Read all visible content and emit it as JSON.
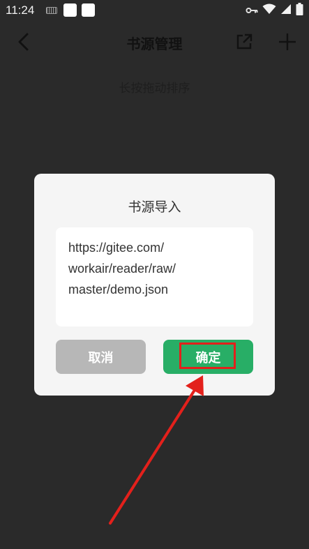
{
  "status_bar": {
    "time": "11:24"
  },
  "toolbar": {
    "title": "书源管理"
  },
  "hint": "长按拖动排序",
  "dialog": {
    "title": "书源导入",
    "url_value": "https://gitee.com/\nworkair/reader/raw/\nmaster/demo.json",
    "cancel_label": "取消",
    "confirm_label": "确定"
  },
  "colors": {
    "overlay": "#2a2a2a",
    "dialog_bg": "#f5f5f5",
    "cancel_bg": "#b7b7b7",
    "confirm_bg": "#28ae66",
    "annotation": "#e3201b"
  },
  "icons": {
    "back": "chevron-left-icon",
    "share": "external-link-icon",
    "add": "plus-icon"
  }
}
